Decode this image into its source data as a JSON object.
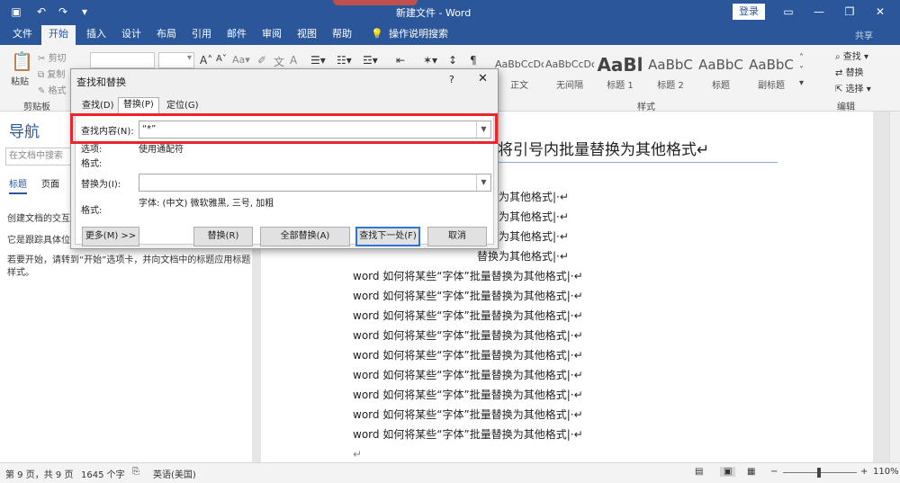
{
  "window": {
    "title": "新建文件 - Word",
    "login_label": "登录"
  },
  "menu": {
    "tabs": [
      "文件",
      "开始",
      "插入",
      "设计",
      "布局",
      "引用",
      "邮件",
      "审阅",
      "视图",
      "帮助"
    ],
    "tell_me": "操作说明搜索",
    "share": "共享"
  },
  "ribbon": {
    "paste": "粘贴",
    "cut": "剪切",
    "copy": "复制",
    "format_painter": "格式",
    "clipboard_label": "剪贴板",
    "grow_font": "A",
    "shrink_font": "A",
    "change_case": "Aa",
    "styles": [
      {
        "sample": "AaBbCcDc",
        "name": "正文"
      },
      {
        "sample": "AaBbCcDc",
        "name": "无间隔"
      },
      {
        "sample": "AaBl",
        "name": "标题 1"
      },
      {
        "sample": "AaBbC",
        "name": "标题 2"
      },
      {
        "sample": "AaBbC",
        "name": "标题"
      },
      {
        "sample": "AaBbC",
        "name": "副标题"
      }
    ],
    "styles_label": "样式",
    "find": "查找",
    "replace": "替换",
    "select": "选择",
    "editing_label": "编辑"
  },
  "nav": {
    "title": "导航",
    "search_placeholder": "在文档中搜索",
    "tabs": [
      "标题",
      "页面"
    ],
    "lines": [
      "创建文档的交互式",
      "它是跟踪具体位置",
      "若要开始，请转到“开始”选项卡，并向文档中的标题应用标题",
      "样式。"
    ]
  },
  "document": {
    "heading": "将引号内批量替换为其他格式",
    "partial_lines": [
      "替换为其他格式",
      "替换为其他格式",
      "替换为其他格式",
      "替换为其他格式"
    ],
    "full_line": "word 如何将某些“字体”批量替换为其他格式"
  },
  "dialog": {
    "title": "查找和替换",
    "help": "?",
    "tabs": [
      "查找(D)",
      "替换(P)",
      "定位(G)"
    ],
    "find_label": "查找内容(N):",
    "find_value": "“*”",
    "options_label": "选项:",
    "options_value": "使用通配符",
    "format_label": "格式:",
    "replace_label": "替换为(I):",
    "replace_value": "",
    "replace_format_value": "字体: (中文) 微软雅黑, 三号, 加粗",
    "buttons": {
      "more": "更多(M) >>",
      "replace": "替换(R)",
      "replace_all": "全部替换(A)",
      "find_next": "查找下一处(F)",
      "cancel": "取消"
    }
  },
  "status": {
    "page": "第 9 页，共 9 页",
    "words": "1645 个字",
    "language": "英语(美国)",
    "zoom": "110%"
  },
  "colors": {
    "accent": "#2b579a",
    "highlight": "#e8262b"
  }
}
